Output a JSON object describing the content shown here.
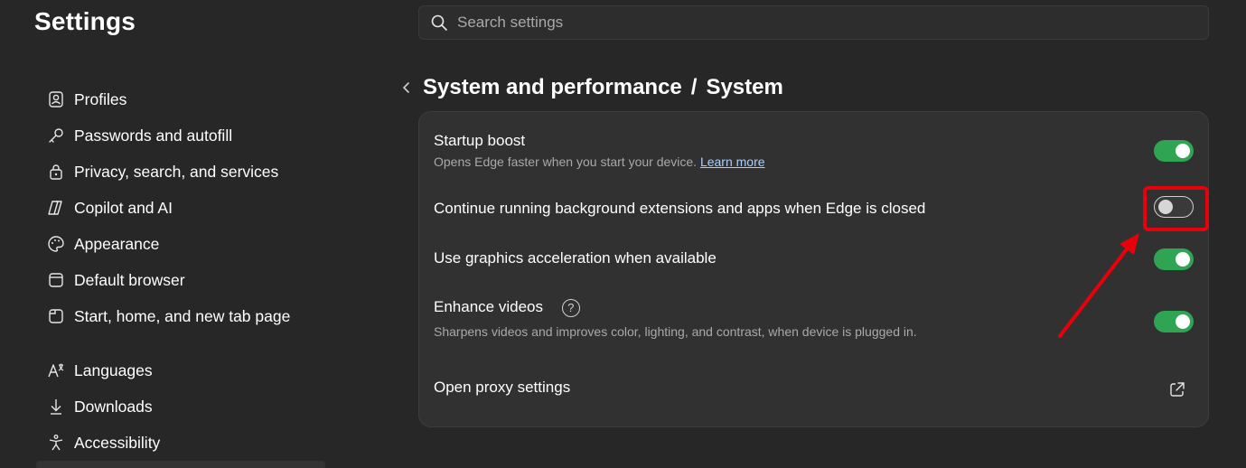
{
  "app": {
    "title": "Settings"
  },
  "search": {
    "placeholder": "Search settings"
  },
  "sidebar": {
    "items": [
      {
        "label": "Profiles",
        "icon": "profile-icon"
      },
      {
        "label": "Passwords and autofill",
        "icon": "key-icon"
      },
      {
        "label": "Privacy, search, and services",
        "icon": "lock-icon"
      },
      {
        "label": "Copilot and AI",
        "icon": "copilot-icon"
      },
      {
        "label": "Appearance",
        "icon": "palette-icon"
      },
      {
        "label": "Default browser",
        "icon": "browser-icon"
      },
      {
        "label": "Start, home, and new tab page",
        "icon": "home-tab-icon"
      },
      {
        "label": "Languages",
        "icon": "language-icon"
      },
      {
        "label": "Downloads",
        "icon": "download-icon"
      },
      {
        "label": "Accessibility",
        "icon": "accessibility-icon"
      }
    ]
  },
  "breadcrumb": {
    "parent": "System and performance",
    "separator": "/",
    "current": "System"
  },
  "settings": {
    "startup_boost": {
      "label": "Startup boost",
      "desc": "Opens Edge faster when you start your device.",
      "link": "Learn more",
      "enabled": true
    },
    "background": {
      "label": "Continue running background extensions and apps when Edge is closed",
      "enabled": false
    },
    "graphics": {
      "label": "Use graphics acceleration when available",
      "enabled": true
    },
    "enhance_videos": {
      "label": "Enhance videos",
      "desc": "Sharpens videos and improves color, lighting, and contrast, when device is plugged in.",
      "help_glyph": "?",
      "enabled": true
    },
    "proxy": {
      "label": "Open proxy settings",
      "icon": "external-link-icon"
    }
  },
  "colors": {
    "toggle_on": "#2fa553",
    "highlight": "#e8000b",
    "link": "#a6d0ff"
  }
}
